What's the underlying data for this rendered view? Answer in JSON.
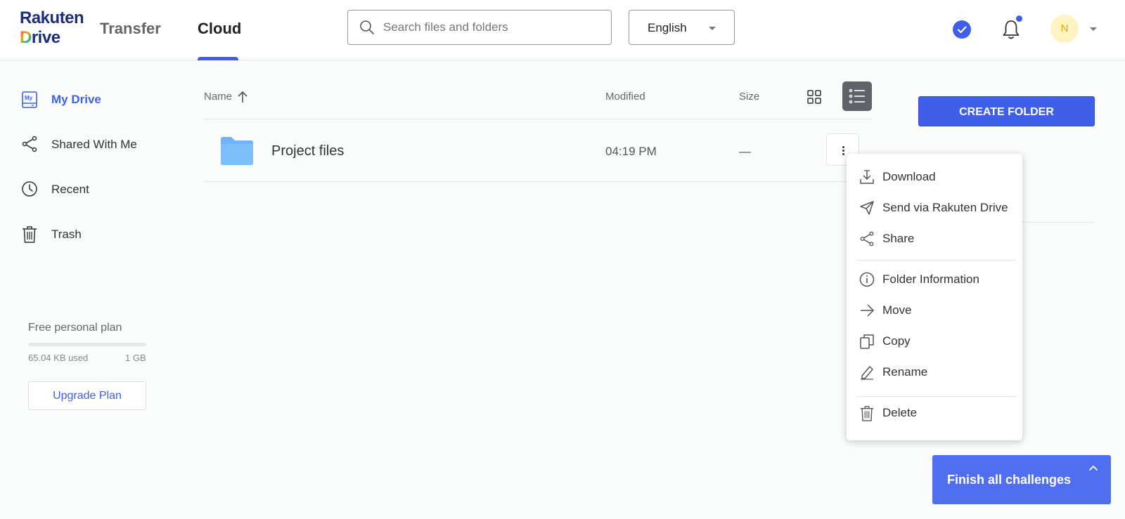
{
  "header": {
    "logo_line1": "Rakuten",
    "logo_line2_first": "D",
    "logo_line2_rest": "rive",
    "tabs": [
      {
        "label": "Transfer"
      },
      {
        "label": "Cloud"
      }
    ],
    "search": {
      "placeholder": "Search files and folders",
      "value": ""
    },
    "language": "English",
    "avatar_initial": "N"
  },
  "sidebar": {
    "items": [
      {
        "label": "My Drive",
        "icon": "my-drive-icon",
        "icon_text": "My"
      },
      {
        "label": "Shared With Me",
        "icon": "share-icon"
      },
      {
        "label": "Recent",
        "icon": "clock-icon"
      },
      {
        "label": "Trash",
        "icon": "trash-icon"
      }
    ],
    "plan": {
      "label": "Free personal plan",
      "used": "65.04 KB used",
      "total": "1 GB",
      "upgrade_label": "Upgrade Plan"
    }
  },
  "list": {
    "columns": {
      "name": "Name",
      "modified": "Modified",
      "size": "Size"
    },
    "rows": [
      {
        "name": "Project files",
        "modified": "04:19 PM",
        "size": "—"
      }
    ]
  },
  "actions": {
    "create_folder": "CREATE FOLDER"
  },
  "context_menu": {
    "items": [
      {
        "label": "Download",
        "icon": "download-icon"
      },
      {
        "label": "Send via Rakuten Drive",
        "icon": "send-icon"
      },
      {
        "label": "Share",
        "icon": "share-icon"
      },
      {
        "label": "Folder Information",
        "icon": "info-icon"
      },
      {
        "label": "Move",
        "icon": "arrow-right-icon"
      },
      {
        "label": "Copy",
        "icon": "copy-icon"
      },
      {
        "label": "Rename",
        "icon": "pencil-icon"
      },
      {
        "label": "Delete",
        "icon": "trash-icon"
      }
    ]
  },
  "challenge": {
    "label": "Finish all challenges"
  },
  "colors": {
    "accent": "#3f5fe8",
    "folder": "#6fb4f7",
    "avatar_bg": "#fff3c4"
  }
}
